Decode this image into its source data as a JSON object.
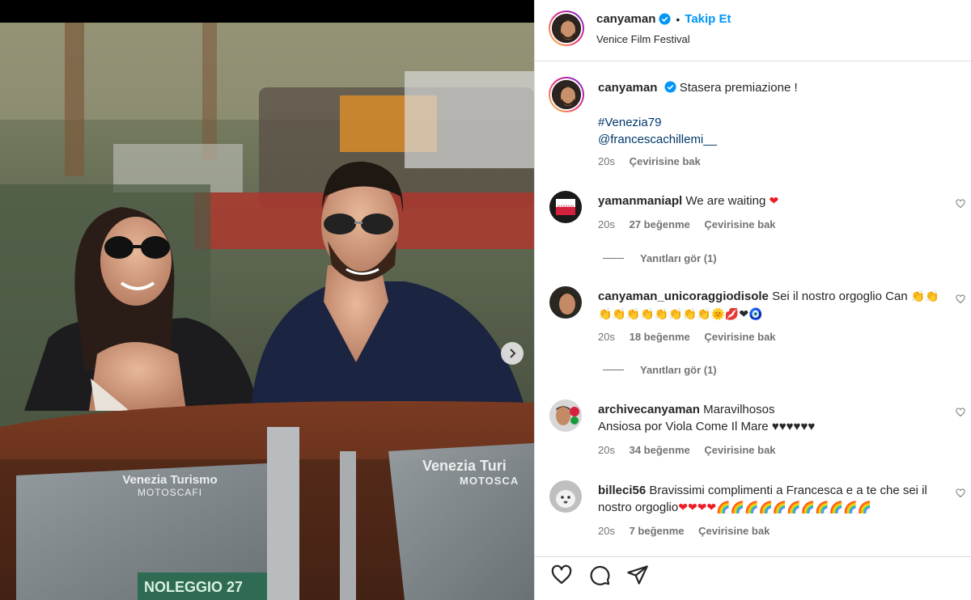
{
  "header": {
    "username": "canyaman",
    "dot": "•",
    "follow_label": "Takip Et",
    "location": "Venice Film Festival"
  },
  "caption": {
    "username": "canyaman",
    "text": "Stasera premiazione !",
    "hashtag": "#Venezia79",
    "mention": "@francescachillemi__",
    "time": "20s",
    "translate": "Çevirisine bak"
  },
  "comments": [
    {
      "username": "yamanmaniapl",
      "text": "We are waiting",
      "emoji": "❤",
      "time": "20s",
      "likes": "27 beğenme",
      "translate": "Çevirisine bak",
      "replies": "Yanıtları gör (1)"
    },
    {
      "username": "canyaman_unicoraggiodisole",
      "text": "Sei il nostro orgoglio Can",
      "emoji_line1": "👏👏",
      "emoji_line2": "👏👏👏👏👏👏👏👏🌞💋❤🧿",
      "time": "20s",
      "likes": "18 beğenme",
      "translate": "Çevirisine bak",
      "replies": "Yanıtları gör (1)"
    },
    {
      "username": "archivecanyaman",
      "text": "Maravilhosos",
      "text2": "Ansiosa por Viola Come Il Mare ♥♥♥♥♥♥",
      "time": "20s",
      "likes": "34 beğenme",
      "translate": "Çevirisine bak"
    },
    {
      "username": "billeci56",
      "text": "Bravissimi complimenti a Francesca e a te che sei il",
      "text2": "nostro orgoglio",
      "emoji": "❤❤❤❤🌈🌈🌈🌈🌈🌈🌈🌈🌈🌈🌈",
      "time": "20s",
      "likes": "7 beğenme",
      "translate": "Çevirisine bak"
    }
  ],
  "photo": {
    "sign_left_line1": "Venezia Turismo",
    "sign_left_line2": "MOTOSCAFI",
    "sign_right_line1": "Venezia Turi",
    "sign_right_line2": "MOTOSCA",
    "plate": "NOLEGGIO 27"
  },
  "colors": {
    "accent": "#0095f6",
    "verified": "#0095f6",
    "muted": "#737373",
    "link": "#00376b",
    "heart": "#ed1c24"
  },
  "icons": [
    "heart-icon",
    "comment-icon",
    "share-icon",
    "verified-icon",
    "chevron-right-icon"
  ]
}
